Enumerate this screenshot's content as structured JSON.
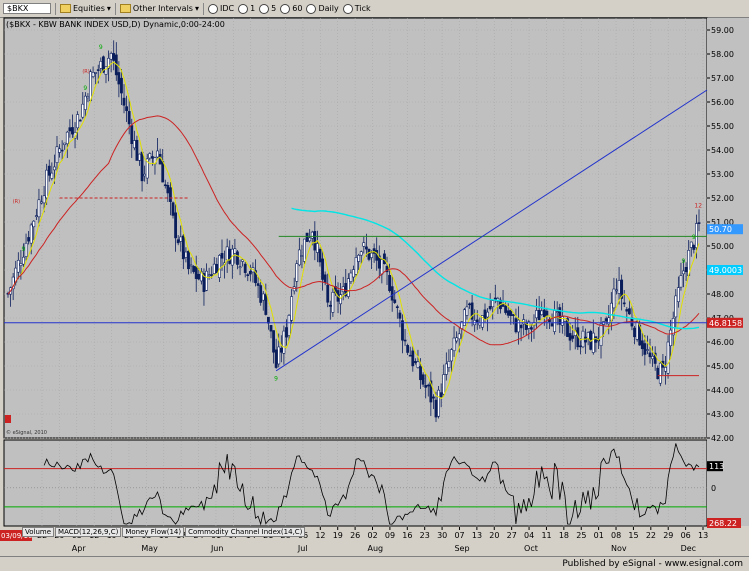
{
  "toolbar": {
    "symbol": "$BKX",
    "items": [
      {
        "label": "Equities",
        "icon": "folder-icon"
      },
      {
        "label": "Other Intervals",
        "icon": "folder-icon"
      },
      {
        "label": "IDC",
        "icon": "radio-icon"
      },
      {
        "label": "1",
        "icon": "radio-icon"
      },
      {
        "label": "5",
        "icon": "radio-icon"
      },
      {
        "label": "60",
        "icon": "radio-icon"
      },
      {
        "label": "Daily",
        "icon": "radio-icon"
      },
      {
        "label": "Tick",
        "icon": "radio-icon"
      }
    ]
  },
  "chart_data": [
    {
      "type": "candlestick",
      "title": "($BKX - KBW BANK INDEX USD,D) Dynamic,0:00-24:00",
      "copyright": "© eSignal, 2010",
      "ylim": [
        42.0,
        59.5
      ],
      "y_ticks": [
        "42.00",
        "43.00",
        "44.00",
        "45.00",
        "46.00",
        "47.00",
        "48.00",
        "49.00",
        "50.00",
        "51.00",
        "52.00",
        "53.00",
        "54.00",
        "55.00",
        "56.00",
        "57.00",
        "58.00",
        "59.00"
      ],
      "price_labels": [
        {
          "value": "50.70",
          "color": "#3399ff"
        },
        {
          "value": "49.0003",
          "color": "#00ccff"
        },
        {
          "value": "46.8158",
          "color": "#cc2222"
        }
      ],
      "horizontal_lines": [
        {
          "y": 46.8,
          "color": "#2233cc"
        },
        {
          "y": 50.4,
          "color": "#228822"
        },
        {
          "y": 52.0,
          "color": "#cc2222",
          "dashed": true
        },
        {
          "y": 44.6,
          "color": "#cc2222"
        }
      ],
      "bar_markers": [
        {
          "text": "9",
          "color": "#00aa00"
        },
        {
          "text": "12",
          "color": "#cc2222"
        },
        {
          "text": "(R)",
          "color": "#cc2222"
        }
      ]
    },
    {
      "type": "line",
      "title": "Commodity Channel Index(14,C)",
      "value_label": "113",
      "zero_label": "0",
      "lower_label": "268.22",
      "lower_label_color": "#cc2222"
    }
  ],
  "x_axis": {
    "date_badge": "03/09/10",
    "day_ticks": [
      "22",
      "29",
      "05",
      "12",
      "19",
      "26",
      "03",
      "10",
      "17",
      "24",
      "01",
      "07",
      "14",
      "21",
      "28",
      "06",
      "12",
      "19",
      "26",
      "02",
      "09",
      "16",
      "23",
      "30",
      "07",
      "13",
      "20",
      "27",
      "04",
      "11",
      "18",
      "25",
      "01",
      "08",
      "15",
      "22",
      "29",
      "06",
      "13"
    ],
    "month_labels": [
      "Apr",
      "May",
      "Jun",
      "Jul",
      "Aug",
      "Sep",
      "Oct",
      "Nov",
      "Dec"
    ]
  },
  "tabs": [
    "Volume",
    "MACD(12,26,9,C)",
    "Money Flow(14)",
    "Commodity Channel Index(14,C)"
  ],
  "footer": "Published by eSignal - www.esignal.com",
  "colors": {
    "background": "#c0c0c0",
    "up": "#ffffff",
    "down": "#0b1e5c",
    "green": "#00aa00",
    "red": "#cc2222",
    "blue": "#2233cc",
    "cyan": "#00e5e5",
    "yellow": "#e0e000"
  }
}
